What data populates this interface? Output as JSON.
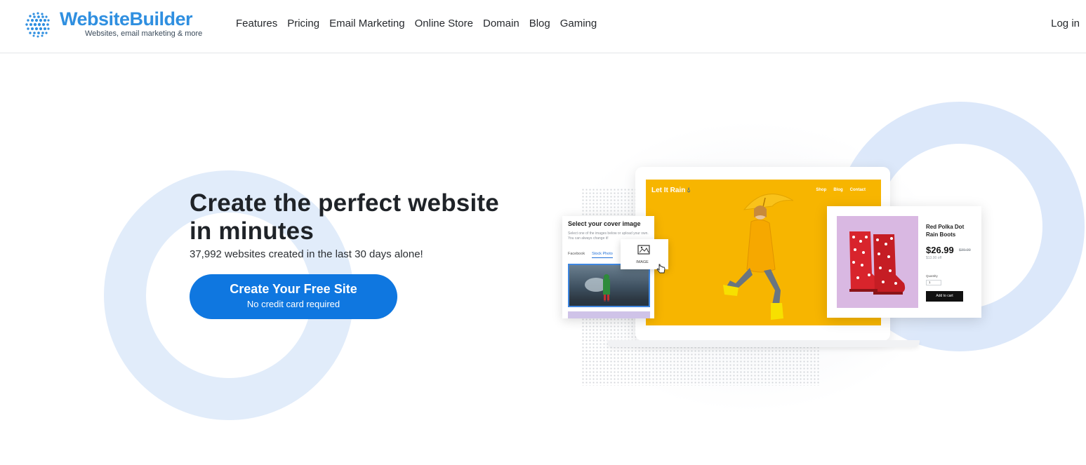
{
  "header": {
    "logo_name": "WebsiteBuilder",
    "logo_tagline": "Websites, email marketing & more",
    "nav": [
      "Features",
      "Pricing",
      "Email Marketing",
      "Online Store",
      "Domain",
      "Blog",
      "Gaming"
    ],
    "login_label": "Log in"
  },
  "hero": {
    "headline": "Create the perfect website in minutes",
    "subline": "37,992 websites created in the last 30 days alone!",
    "cta_main": "Create Your Free Site",
    "cta_sub": "No credit card required"
  },
  "mockup": {
    "site_title": "Let It Rain",
    "site_nav": [
      "Shop",
      "Blog",
      "Contact"
    ],
    "cover_card": {
      "title": "Select your cover image",
      "description": "Select one of the images below or upload your own. You can always change it!",
      "tabs": [
        "Facebook",
        "Stock Photo"
      ],
      "image_chip_label": "IMAGE"
    },
    "product_card": {
      "name": "Red Polka Dot Rain Boots",
      "price": "$26.99",
      "old_price": "$39.99",
      "savings": "$13.00 off",
      "qty_label": "Quantity",
      "qty_value": "1",
      "add_to_cart": "Add to cart"
    }
  },
  "colors": {
    "brand_blue": "#2f8fe0",
    "cta_blue": "#0f77e0",
    "ring_blue": "#e1ecfa",
    "site_yellow": "#f7b500",
    "product_bg": "#d9b8e2"
  }
}
